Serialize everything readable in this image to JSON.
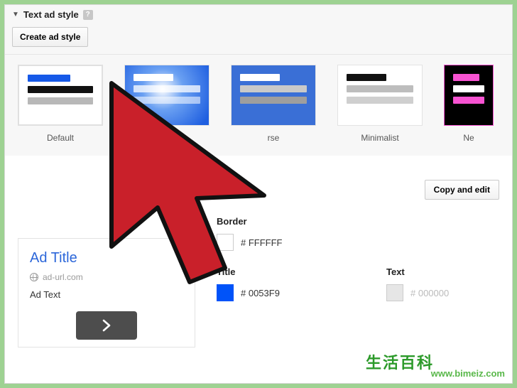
{
  "header": {
    "title": "Text ad style",
    "help_glyph": "?",
    "create_label": "Create ad style"
  },
  "styles": {
    "items": [
      {
        "label": "Default",
        "bars": [
          "#1659e8",
          "#111111",
          "#b8b8b8"
        ],
        "bg": "#ffffff"
      },
      {
        "label": "",
        "bars": [
          "#ffffff",
          "#9fb9e8",
          "#6f95de"
        ],
        "bg": "#1f5fe0",
        "gradient": true
      },
      {
        "label": "rse",
        "bars": [
          "#ffffff",
          "#c9c9c9",
          "#9e9e9e"
        ],
        "bg": "#3a6fd6"
      },
      {
        "label": "Minimalist",
        "bars": [
          "#111111",
          "#bdbdbd",
          "#cfcfcf"
        ],
        "bg": "#ffffff"
      },
      {
        "label": "Ne",
        "bars": [
          "#f853d2",
          "#ffffff",
          "#f853d2"
        ],
        "bg": "#000000"
      }
    ]
  },
  "editor": {
    "selected_name": "Default",
    "copy_label": "Copy and edit",
    "border": {
      "label": "Border",
      "hex": "# FFFFFF",
      "swatch": "#ffffff"
    },
    "title_color": {
      "label": "Title",
      "hex": "# 0053F9",
      "swatch": "#0053f9"
    },
    "text_color": {
      "label": "Text",
      "hex": "# 000000",
      "swatch": "#e6e6e6"
    }
  },
  "preview": {
    "title": "Ad Title",
    "url": "ad-url.com",
    "text": "Ad Text"
  },
  "watermark": {
    "logo_text": "生活百科",
    "url_text": "www.bimeiz.com"
  }
}
